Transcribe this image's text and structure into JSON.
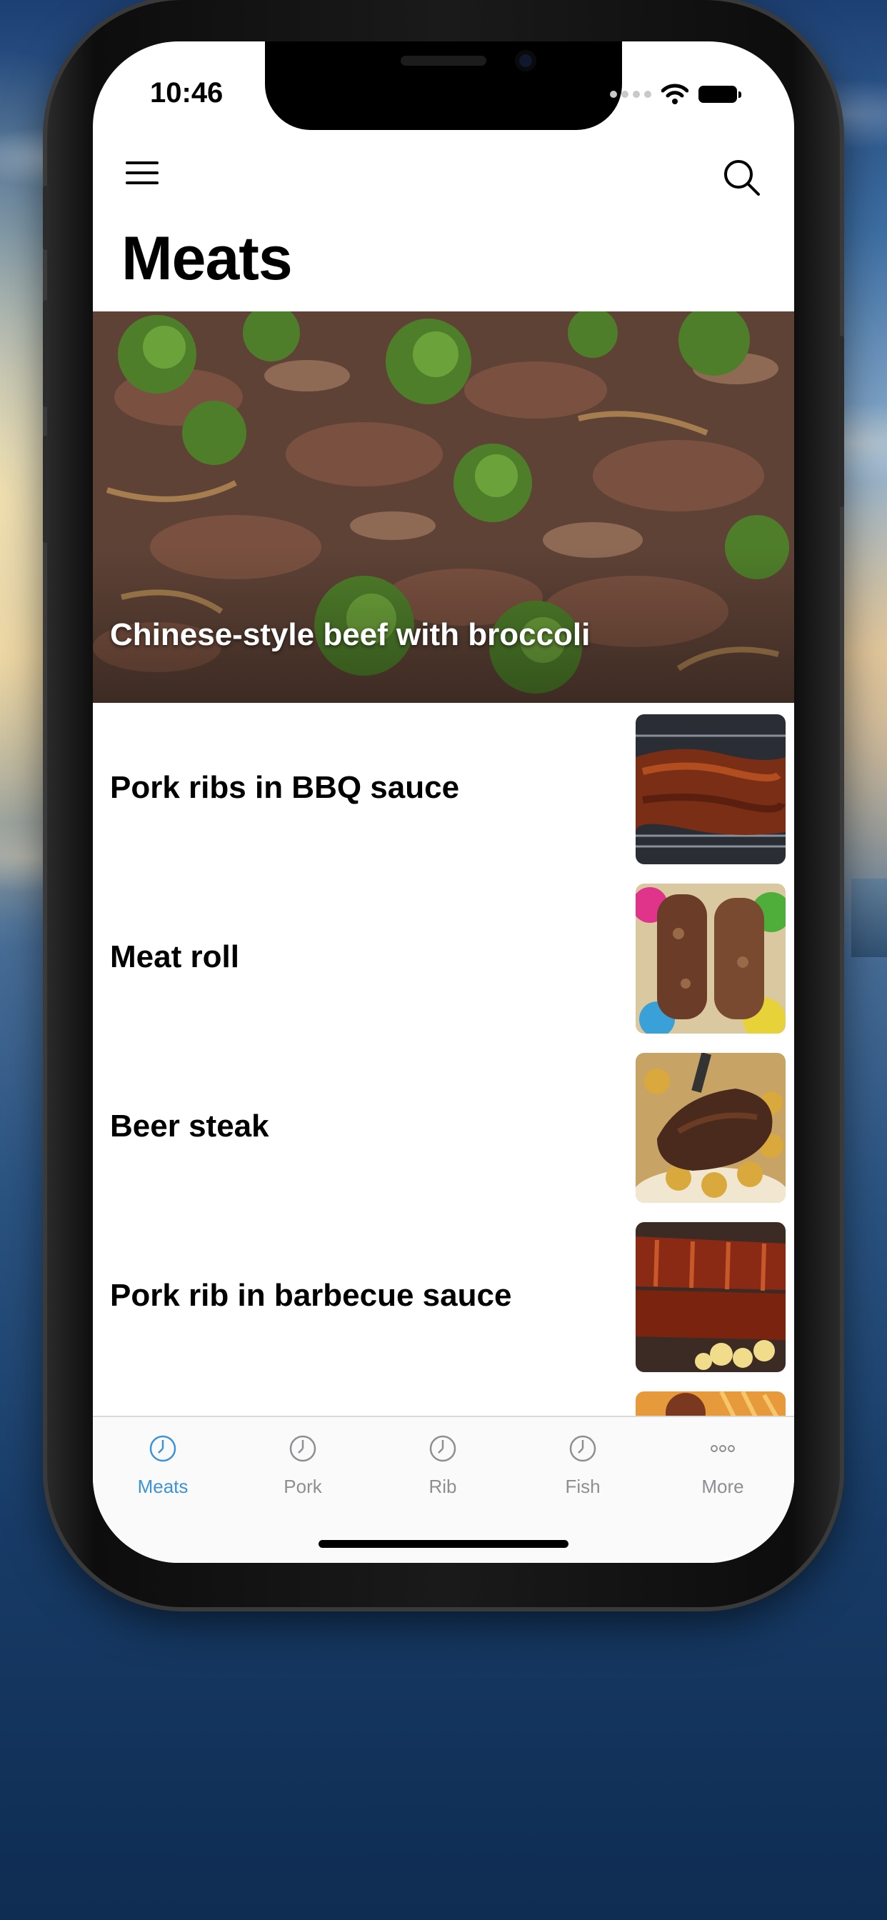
{
  "status_bar": {
    "time": "10:46"
  },
  "header": {
    "title": "Meats"
  },
  "featured": {
    "title": "Chinese-style beef with broccoli"
  },
  "list": [
    {
      "title": "Pork ribs in BBQ sauce"
    },
    {
      "title": "Meat roll"
    },
    {
      "title": "Beer steak"
    },
    {
      "title": "Pork rib in barbecue sauce"
    }
  ],
  "tabs": [
    {
      "label": "Meats",
      "icon": "clock-icon",
      "active": true
    },
    {
      "label": "Pork",
      "icon": "clock-icon",
      "active": false
    },
    {
      "label": "Rib",
      "icon": "clock-icon",
      "active": false
    },
    {
      "label": "Fish",
      "icon": "clock-icon",
      "active": false
    },
    {
      "label": "More",
      "icon": "more-icon",
      "active": false
    }
  ],
  "colors": {
    "accent": "#3d93d6",
    "inactive": "#8e8e93"
  }
}
